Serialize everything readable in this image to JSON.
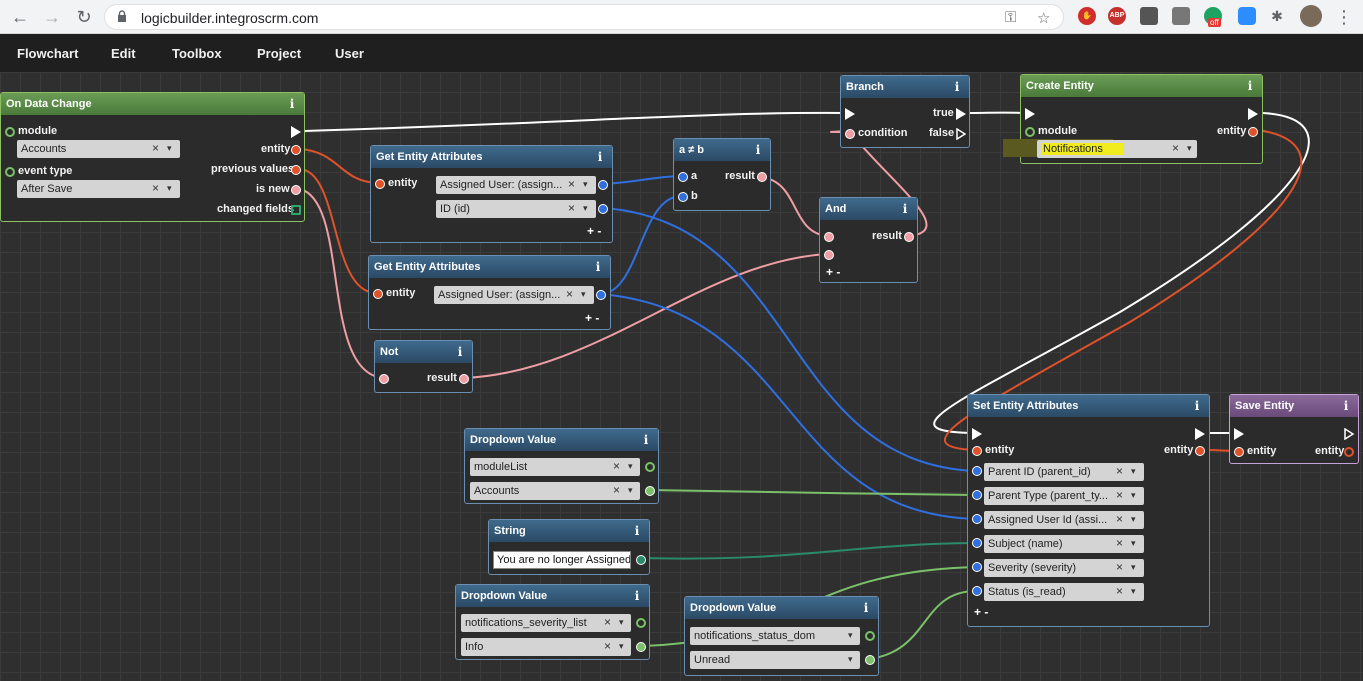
{
  "browser": {
    "url": "logicbuilder.integroscrm.com",
    "ext_abp": "ABP",
    "ext_off": "off"
  },
  "menu": [
    "Flowchart",
    "Edit",
    "Toolbox",
    "Project",
    "User"
  ],
  "nodes": {
    "on_data_change": {
      "title": "On Data Change",
      "module_label": "module",
      "module_value": "Accounts",
      "event_type_label": "event type",
      "event_type_value": "After Save",
      "out_entity": "entity",
      "out_previous": "previous values",
      "out_is_new": "is new",
      "out_changed": "changed fields"
    },
    "get_attrs_1": {
      "title": "Get Entity Attributes",
      "entity_label": "entity",
      "field1": "Assigned User: (assign...",
      "field2": "ID (id)"
    },
    "get_attrs_2": {
      "title": "Get Entity Attributes",
      "entity_label": "entity",
      "field1": "Assigned User: (assign..."
    },
    "not_equal": {
      "title": "a ≠ b",
      "a_label": "a",
      "b_label": "b",
      "result_label": "result"
    },
    "branch": {
      "title": "Branch",
      "true_label": "true",
      "false_label": "false",
      "condition_label": "condition"
    },
    "and": {
      "title": "And",
      "result_label": "result"
    },
    "not": {
      "title": "Not",
      "result_label": "result"
    },
    "create_entity": {
      "title": "Create Entity",
      "module_label": "module",
      "entity_label": "entity",
      "module_value": "Notifications"
    },
    "set_attrs": {
      "title": "Set Entity Attributes",
      "entity_in": "entity",
      "entity_out": "entity",
      "fields": [
        "Parent ID (parent_id)",
        "Parent Type (parent_ty...",
        "Assigned User Id (assi...",
        "Subject (name)",
        "Severity (severity)",
        "Status (is_read)"
      ]
    },
    "save_entity": {
      "title": "Save Entity",
      "entity_in": "entity",
      "entity_out": "entity"
    },
    "dropdown_1": {
      "title": "Dropdown Value",
      "list": "moduleList",
      "value": "Accounts"
    },
    "string": {
      "title": "String",
      "value": "You are no longer Assigned"
    },
    "dropdown_2": {
      "title": "Dropdown Value",
      "list": "notifications_severity_list",
      "value": "Info"
    },
    "dropdown_3": {
      "title": "Dropdown Value",
      "list": "notifications_status_dom",
      "value": "Unread"
    }
  },
  "symbols": {
    "info": "i",
    "clear": "×",
    "dropdown": "▾",
    "plus_minus": "+ -"
  },
  "colors": {
    "wire_exec": "#ffffff",
    "wire_entity": "#e0522a",
    "wire_bool": "#ef9ea4",
    "wire_string": "#2f6fe0",
    "wire_value": "#7ac16a",
    "wire_text": "#2a8a6a",
    "highlight": "#f1ec1d"
  }
}
